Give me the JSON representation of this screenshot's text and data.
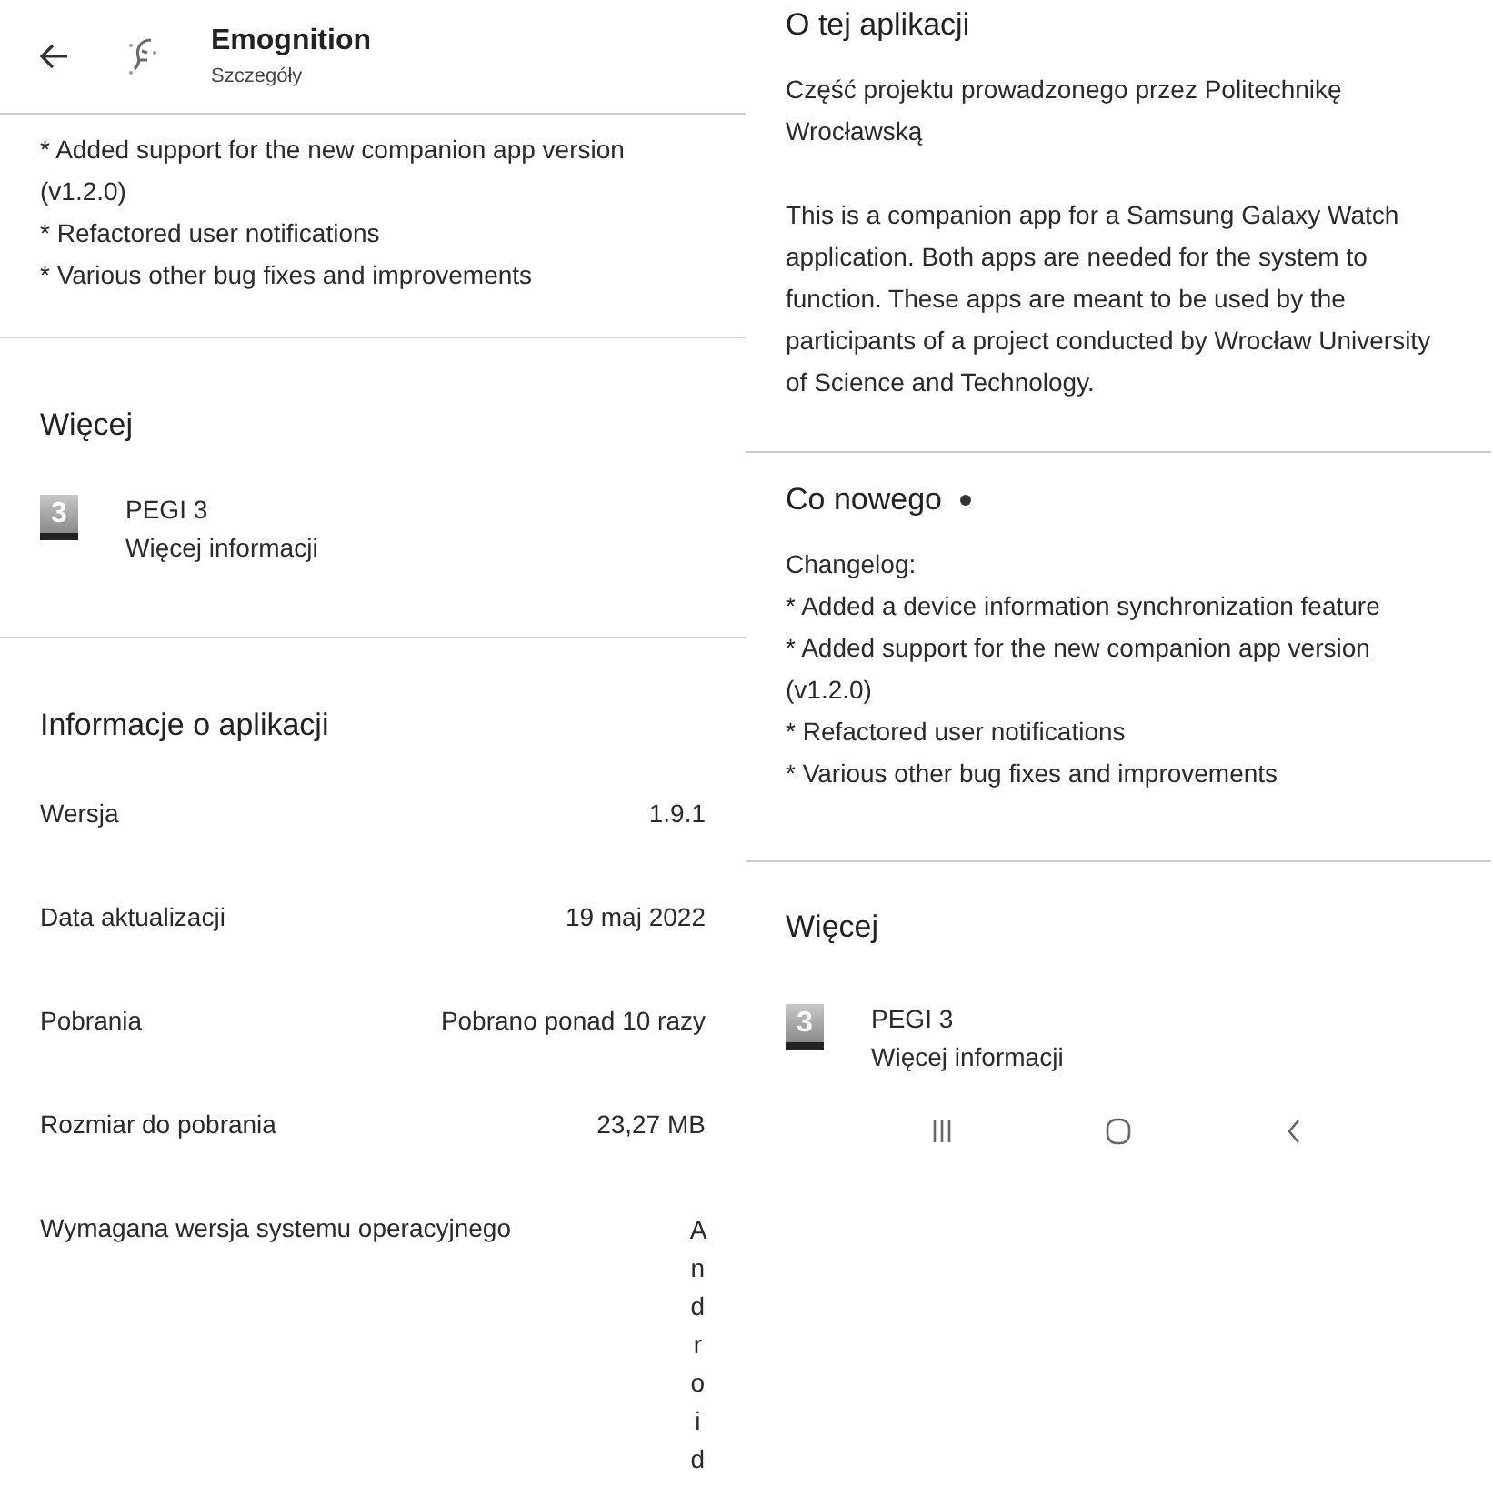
{
  "left_screen": {
    "header": {
      "title": "Emognition",
      "subtitle": "Szczegóły"
    },
    "changelog_lines": [
      "* Added support for the new companion app version (v1.2.0)",
      "* Refactored user notifications",
      "* Various other bug fixes and improvements"
    ],
    "more": {
      "heading": "Więcej",
      "rating": {
        "badge": "3",
        "label": "PEGI 3",
        "link": "Więcej informacji"
      }
    },
    "app_info": {
      "heading": "Informacje o aplikacji",
      "rows": [
        {
          "kind": "row",
          "label": "Wersja",
          "value": "1.9.1"
        },
        {
          "kind": "row",
          "label": "Data aktualizacji",
          "value": "19 maj 2022"
        },
        {
          "kind": "row",
          "label": "Pobrania",
          "value": "Pobrano ponad 10 razy"
        },
        {
          "kind": "row",
          "label": "Rozmiar do pobrania",
          "value": "23,27 MB"
        },
        {
          "kind": "vertical",
          "label": "Wymagana wersja systemu operacyjnego",
          "value": "Android"
        }
      ]
    }
  },
  "right_screen": {
    "about": {
      "heading": "O tej aplikacji",
      "paragraphs": [
        "Część projektu prowadzonego przez Politechnikę Wrocławską",
        "This is a companion app for a Samsung Galaxy Watch application. Both apps are needed for the system to function. These apps are meant to be used by the participants of a project conducted by Wrocław University of Science and Technology."
      ]
    },
    "whats_new": {
      "heading": "Co nowego",
      "new_indicator": true,
      "intro": "Changelog:",
      "lines": [
        "* Added a device information synchronization feature",
        "* Added support for the new companion app version (v1.2.0)",
        "* Refactored user notifications",
        "* Various other bug fixes and improvements"
      ]
    },
    "more": {
      "heading": "Więcej",
      "rating": {
        "badge": "3",
        "label": "PEGI 3",
        "link": "Więcej informacji"
      }
    }
  }
}
